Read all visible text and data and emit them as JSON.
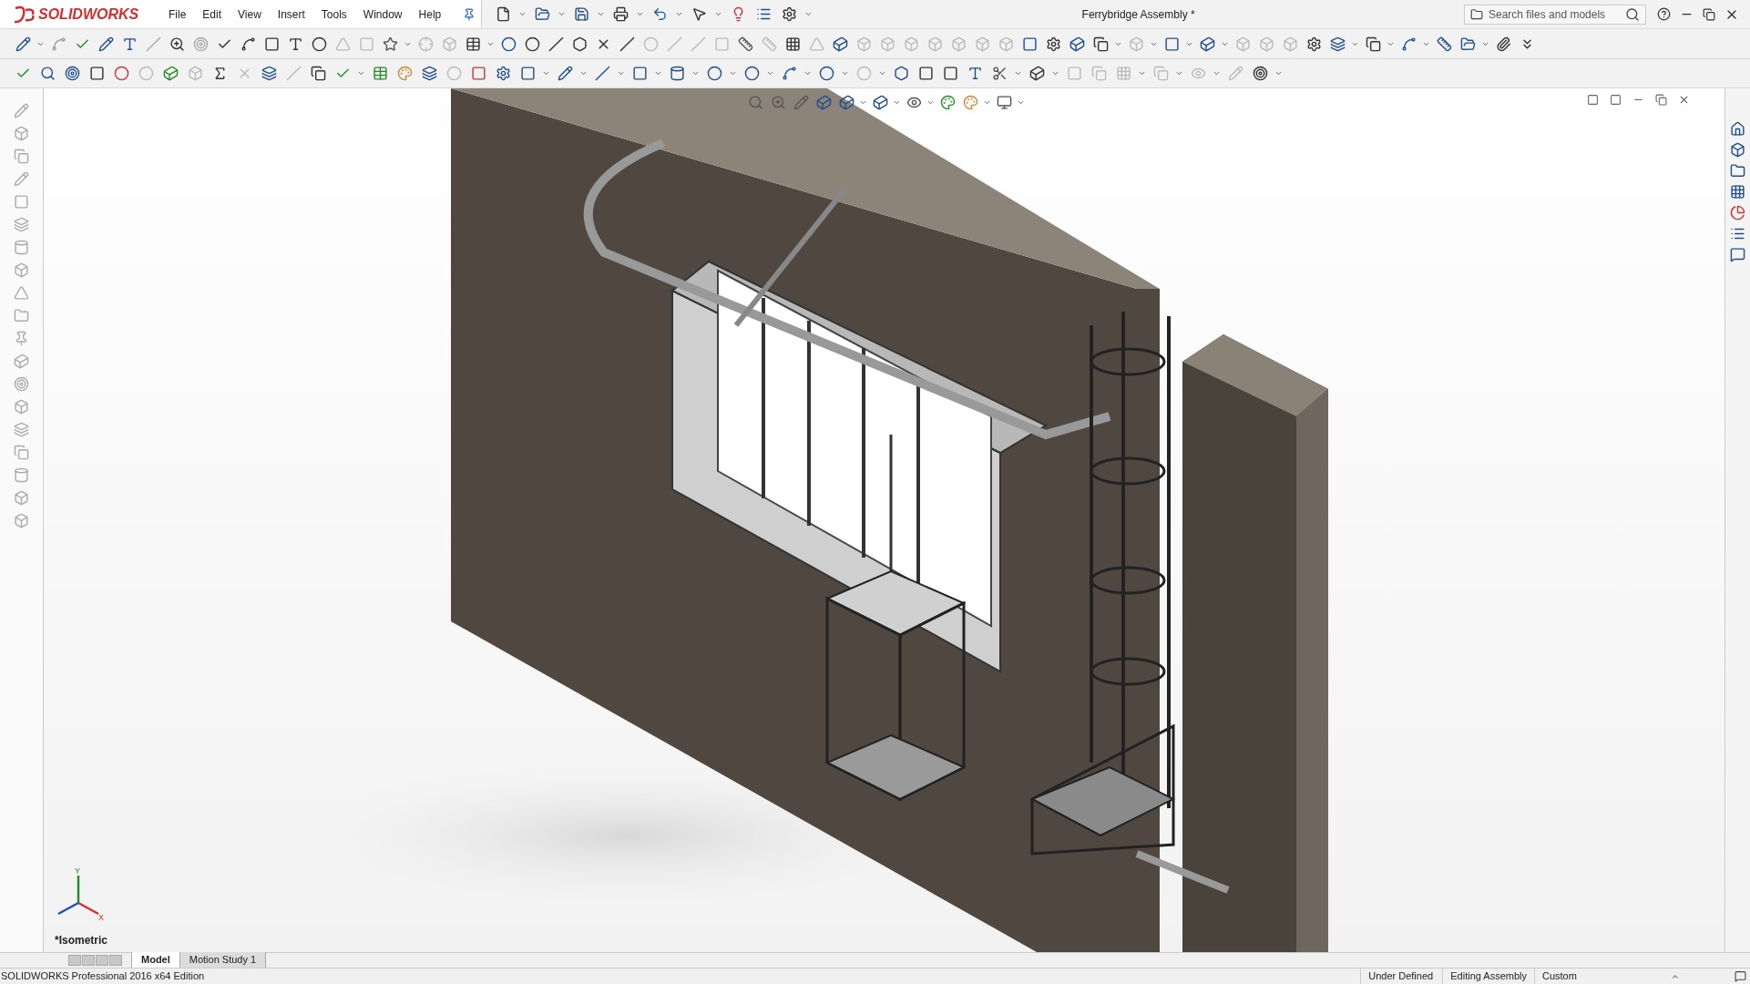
{
  "app": {
    "logo": "SOLIDWORKS"
  },
  "menu": [
    {
      "label": "File"
    },
    {
      "label": "Edit"
    },
    {
      "label": "View"
    },
    {
      "label": "Insert"
    },
    {
      "label": "Tools"
    },
    {
      "label": "Window"
    },
    {
      "label": "Help"
    }
  ],
  "document_title": "Ferrybridge Assembly *",
  "search": {
    "placeholder": "Search files and models"
  },
  "viewport": {
    "view_label": "*Isometric",
    "triad": {
      "x": "X",
      "y": "Y"
    }
  },
  "tabs": [
    {
      "label": "Model",
      "selected": true
    },
    {
      "label": "Motion Study 1",
      "selected": false
    }
  ],
  "status_bar": {
    "product": "SOLIDWORKS Professional 2016 x64 Edition",
    "items": [
      "Under Defined",
      "Editing Assembly",
      "Custom"
    ]
  }
}
